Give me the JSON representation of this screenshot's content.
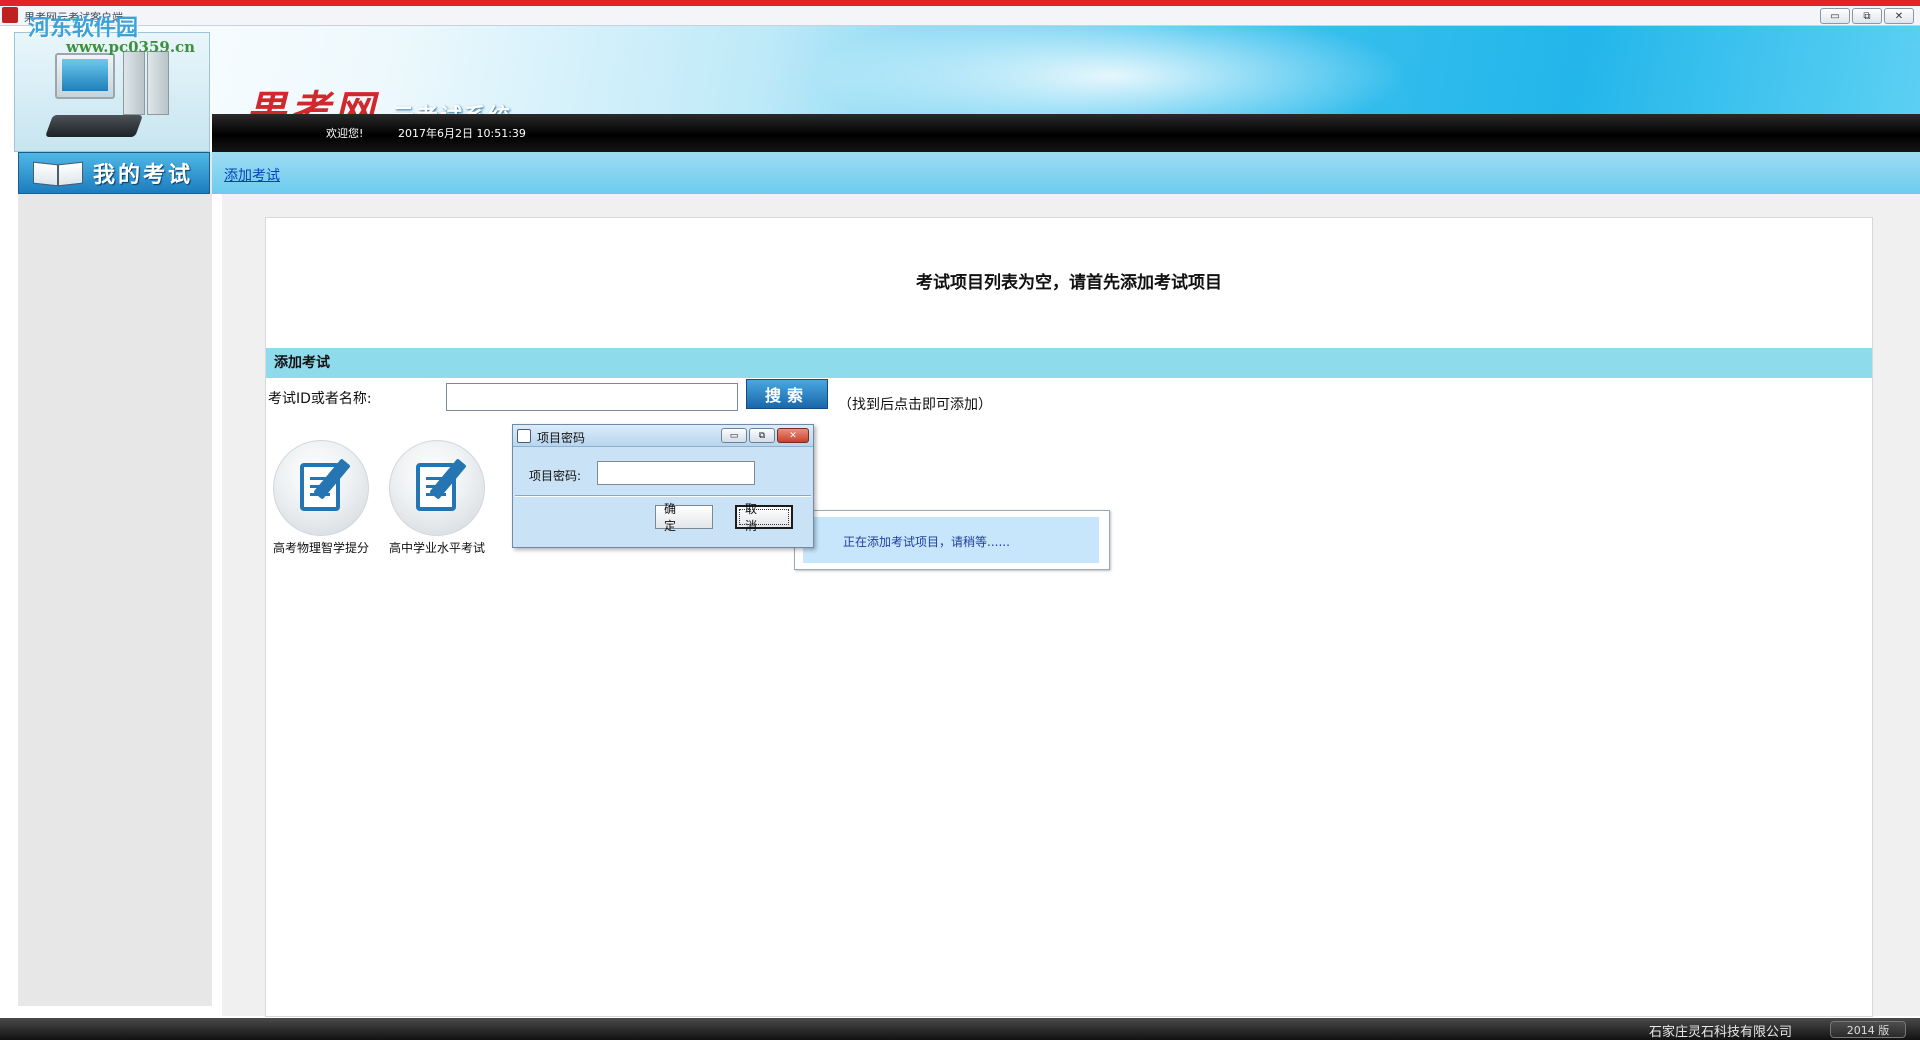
{
  "window": {
    "title": "果考网云考试客户端",
    "buttons": {
      "minimize": "▭",
      "restore": "⧉",
      "close": "✕"
    }
  },
  "watermark": {
    "line1": "河东软件园",
    "line2": "www.pc0359.cn"
  },
  "header": {
    "brand_logo": "果考网",
    "subtitle": "云考试系统",
    "welcome": "欢迎您!",
    "datetime": "2017年6月2日 10:51:39"
  },
  "sidebar": {
    "my_exam_label": "我的考试"
  },
  "subnav": {
    "add_exam_link": "添加考试"
  },
  "main": {
    "empty_message": "考试项目列表为空，请首先添加考试项目",
    "section_title": "添加考试",
    "search": {
      "label": "考试ID或者名称:",
      "value": "",
      "button_label": "搜索",
      "hint": "（找到后点击即可添加）"
    },
    "exam_items": [
      {
        "name": "高考物理智学提分",
        "icon": "document-edit-icon"
      },
      {
        "name": "高中学业水平考试",
        "icon": "document-edit-icon"
      }
    ]
  },
  "progress": {
    "message": "正在添加考试项目，请稍等......"
  },
  "dialog": {
    "title": "项目密码",
    "buttons": {
      "minimize": "▭",
      "restore": "⧉",
      "close": "✕"
    },
    "password_label": "项目密码:",
    "password_value": "",
    "ok_label": "确 定",
    "cancel_label": "取 消"
  },
  "footer": {
    "company": "石家庄灵石科技有限公司",
    "version": "2014 版"
  },
  "colors": {
    "accent_blue": "#23b6ea",
    "section_head": "#8edbec",
    "title_red": "#e0222a",
    "brand_red": "#d0282d"
  }
}
